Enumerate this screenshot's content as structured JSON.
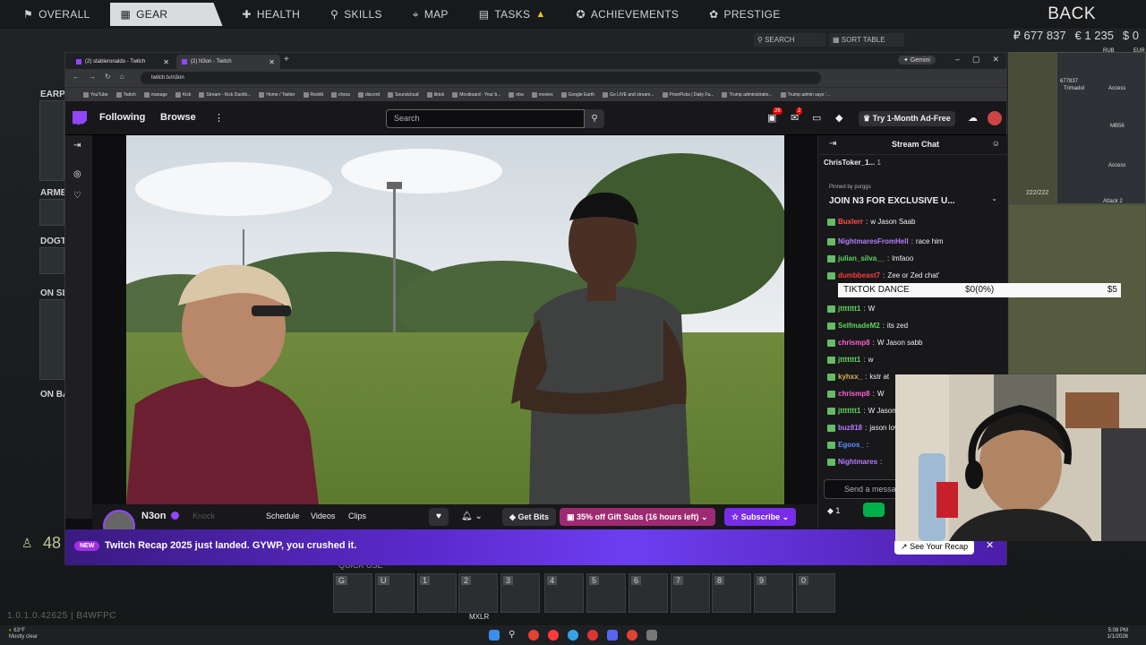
{
  "game": {
    "nav": [
      {
        "icon": "person-icon",
        "glyph": "⚑",
        "label": "OVERALL"
      },
      {
        "icon": "gear-icon",
        "glyph": "▦",
        "label": "GEAR"
      },
      {
        "icon": "health-icon",
        "glyph": "✚",
        "label": "HEALTH"
      },
      {
        "icon": "skills-icon",
        "glyph": "⚲",
        "label": "SKILLS"
      },
      {
        "icon": "map-icon",
        "glyph": "⌖",
        "label": "MAP"
      },
      {
        "icon": "tasks-icon",
        "glyph": "▤",
        "label": "TASKS"
      },
      {
        "icon": "achievements-icon",
        "glyph": "✪",
        "label": "ACHIEVEMENTS"
      },
      {
        "icon": "prestige-icon",
        "glyph": "✿",
        "label": "PRESTIGE"
      }
    ],
    "back": "BACK",
    "roubles": "₽ 677 837",
    "euros": "€ 1 235",
    "dollars": "$ 0",
    "search": "SEARCH",
    "sort": "SORT TABLE",
    "left_labels": [
      "EARPI",
      "ARMB",
      "DOGT",
      "ON SL",
      "ON BA"
    ],
    "quick_use": "QUICK USE",
    "quick_slots": [
      "G",
      "U",
      "1",
      "2",
      "3",
      "4",
      "5",
      "6",
      "7",
      "8",
      "9",
      "0"
    ],
    "mxlr": "MXLR",
    "version": "1.0.1.0.42625 | B4WFPC",
    "counter": "48",
    "right_labels": [
      "RUB",
      "EUR",
      "677837",
      "Trimadol",
      "Access",
      "MB56",
      "Access",
      "222/222",
      "Attack 2"
    ]
  },
  "taskbar": {
    "weather_temp": "63°F",
    "weather_desc": "Mostly clear",
    "time": "5:08 PM",
    "date": "1/1/2026"
  },
  "browser": {
    "tabs": [
      {
        "title": "(2) stableronaldo - Twitch",
        "active": false
      },
      {
        "title": "(2) N3on - Twitch",
        "active": true
      }
    ],
    "gemini": "✦ Gemini",
    "url": "twitch.tv/n3on",
    "bookmarks": [
      "YouTube",
      "Twitch",
      "manage",
      "Kick",
      "Stream - Kick Dashb...",
      "Home / Twitter",
      "Reddit",
      "chess",
      "discord",
      "Soundcloud",
      "tiktok",
      "Moviboard - Your b...",
      "nba",
      "movies",
      "Google Earth",
      "Go LIVE and stream...",
      "PrizePicks | Daily Fa...",
      "Trump administratio...",
      "Trump admin says '..."
    ]
  },
  "twitch": {
    "following": "Following",
    "browse": "Browse",
    "search_placeholder": "Search",
    "notif_count": "26",
    "inbox_count": "2",
    "prime": "Try 1-Month Ad-Free",
    "channel_name": "N3on",
    "knock": "Knock",
    "channel_tabs": [
      "Schedule",
      "Videos",
      "Clips"
    ],
    "get_bits": "Get Bits",
    "gift_subs": "35% off Gift Subs (16 hours left)",
    "subscribe": "Subscribe",
    "recap_badge": "NEW",
    "recap_text": "Twitch Recap 2025 just landed. GYWP, you crushed it.",
    "recap_button": "See Your Recap"
  },
  "chat": {
    "title": "Stream Chat",
    "top_chatter": "ChrisToker_1...",
    "top_count": "1",
    "pinned_by": "Pinned by purggs",
    "pinned_msg": "JOIN N3 FOR EXCLUSIVE U...",
    "messages": [
      {
        "user": "Buxlerr",
        "color": "#ff4f4f",
        "text": "w Jason Saab"
      },
      {
        "user": "NightmaresFromHell",
        "color": "#b37bff",
        "text": "race him"
      },
      {
        "user": "julian_silva__",
        "color": "#5fd35f",
        "text": "lmfaoo"
      },
      {
        "user": "dumbbeast7",
        "color": "#ff3c3c",
        "text": "Zee or Zed chat'"
      },
      {
        "user": "jttttttt1",
        "color": "#5fd35f",
        "text": "W"
      },
      {
        "user": "SelfmadeM2",
        "color": "#5fd35f",
        "text": "its zed"
      },
      {
        "user": "chrismp8",
        "color": "#ff5fd1",
        "text": "W Jason sabb"
      },
      {
        "user": "jttttttt1",
        "color": "#5fd35f",
        "text": "w"
      },
      {
        "user": "kyhxx_",
        "color": "#d9b34a",
        "text": "kstr at"
      },
      {
        "user": "chrismp8",
        "color": "#ff5fd1",
        "text": "W"
      },
      {
        "user": "jttttttt1",
        "color": "#5fd35f",
        "text": "W Jason"
      },
      {
        "user": "buz818",
        "color": "#b37bff",
        "text": "jason lov"
      },
      {
        "user": "Egoos_",
        "color": "#5f8fff",
        "text": ""
      },
      {
        "user": "Nightmares",
        "color": "#b37bff",
        "text": ""
      }
    ],
    "input_placeholder": "Send a message",
    "bits_count": "1"
  },
  "overlay": {
    "name": "TIKTOK DANCE",
    "value": "$0(0%)",
    "price": "$5"
  }
}
